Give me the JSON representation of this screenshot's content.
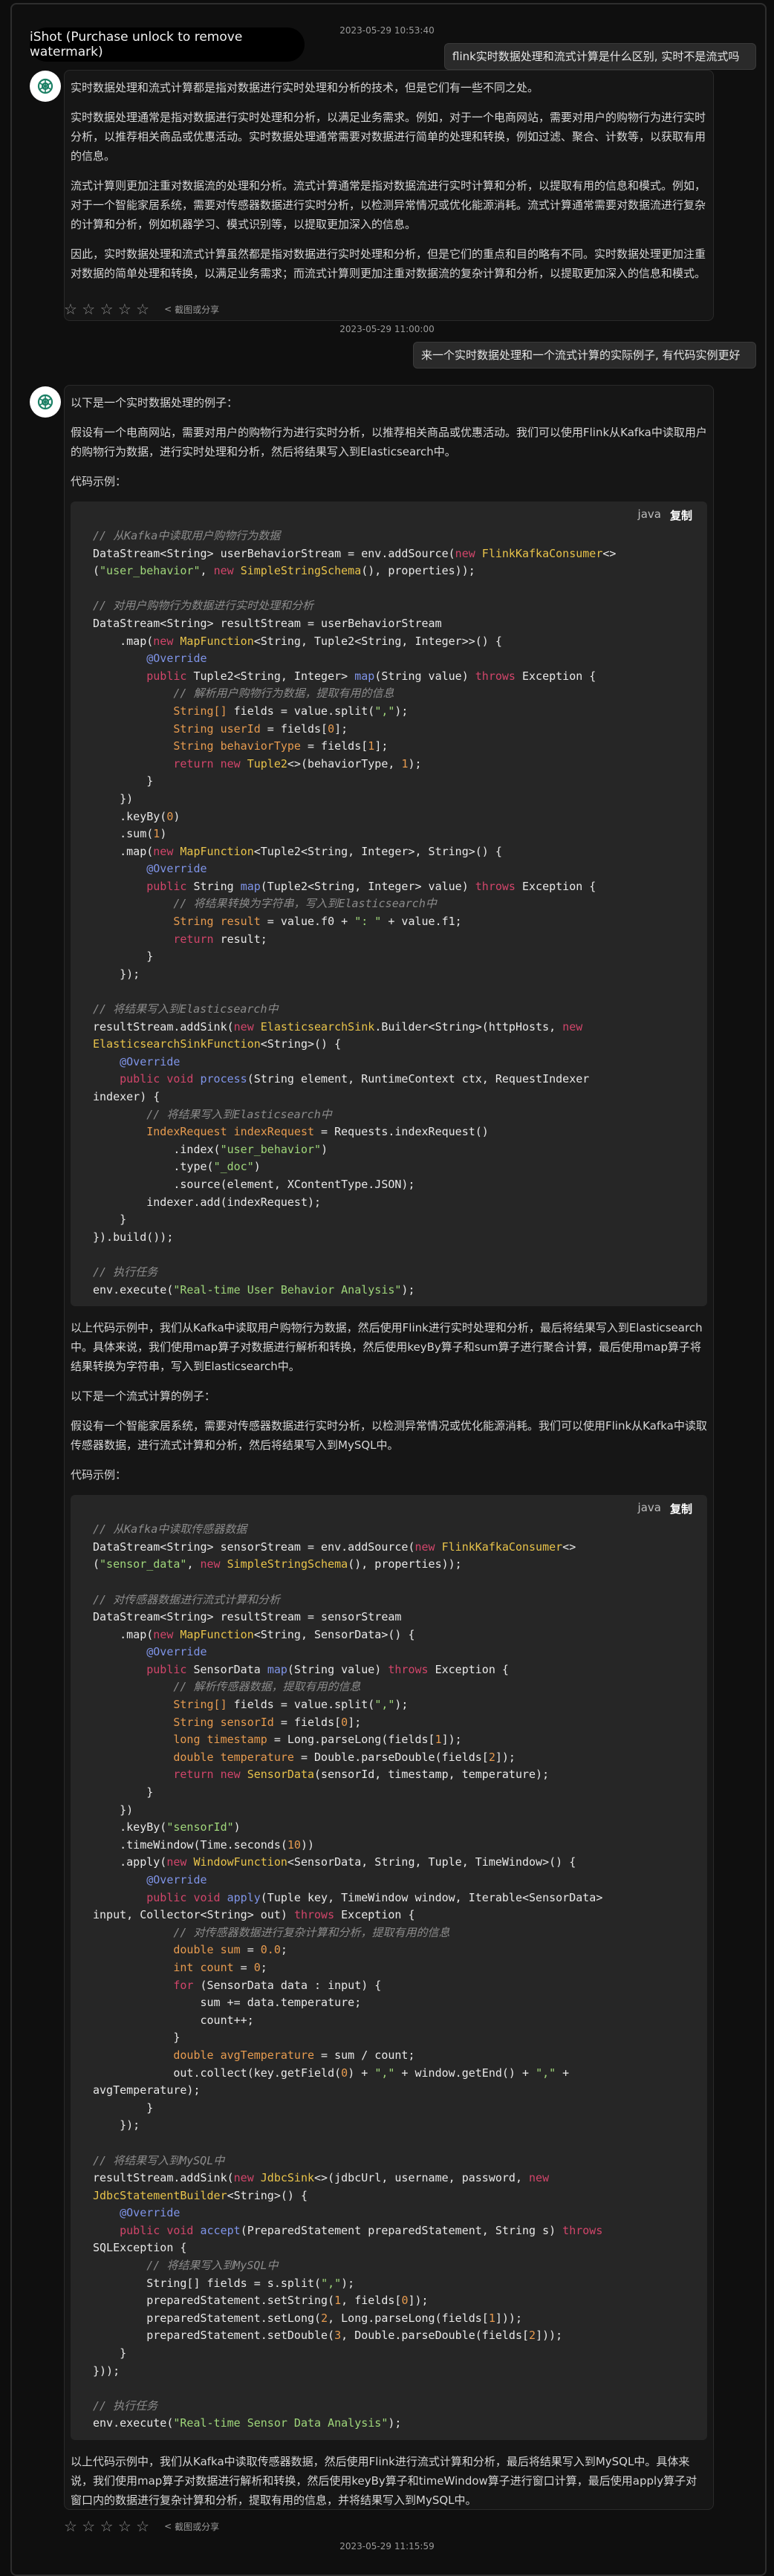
{
  "watermark": "iShot (Purchase unlock to remove watermark)",
  "timestamps": {
    "t1": "2023-05-29 10:53:40",
    "t2": "2023-05-29 11:00:00",
    "t3": "2023-05-29 11:15:59"
  },
  "user": {
    "q1": "flink实时数据处理和流式计算是什么区别, 实时不是流式吗",
    "q2": "来一个实时数据处理和一个流式计算的实际例子, 有代码实例更好"
  },
  "answer1": {
    "p1": "实时数据处理和流式计算都是指对数据进行实时处理和分析的技术，但是它们有一些不同之处。",
    "p2": "实时数据处理通常是指对数据进行实时处理和分析，以满足业务需求。例如，对于一个电商网站，需要对用户的购物行为进行实时分析，以推荐相关商品或优惠活动。实时数据处理通常需要对数据进行简单的处理和转换，例如过滤、聚合、计数等，以获取有用的信息。",
    "p3": "流式计算则更加注重对数据流的处理和分析。流式计算通常是指对数据流进行实时计算和分析，以提取有用的信息和模式。例如，对于一个智能家居系统，需要对传感器数据进行实时分析，以检测异常情况或优化能源消耗。流式计算通常需要对数据流进行复杂的计算和分析，例如机器学习、模式识别等，以提取更加深入的信息。",
    "p4": "因此，实时数据处理和流式计算虽然都是指对数据进行实时处理和分析，但是它们的重点和目的略有不同。实时数据处理更加注重对数据的简单处理和转换，以满足业务需求；而流式计算则更加注重对数据流的复杂计算和分析，以提取更加深入的信息和模式。"
  },
  "answer2": {
    "intro": "以下是一个实时数据处理的例子：",
    "p1": "假设有一个电商网站，需要对用户的购物行为进行实时分析，以推荐相关商品或优惠活动。我们可以使用Flink从Kafka中读取用户的购物行为数据，进行实时处理和分析，然后将结果写入到Elasticsearch中。",
    "codeLabel1": "代码示例：",
    "lang": "java",
    "copy": "复制",
    "p2": "以上代码示例中，我们从Kafka中读取用户购物行为数据，然后使用Flink进行实时处理和分析，最后将结果写入到Elasticsearch中。具体来说，我们使用map算子对数据进行解析和转换，然后使用keyBy算子和sum算子进行聚合计算，最后使用map算子将结果转换为字符串，写入到Elasticsearch中。",
    "intro2": "以下是一个流式计算的例子：",
    "p3": "假设有一个智能家居系统，需要对传感器数据进行实时分析，以检测异常情况或优化能源消耗。我们可以使用Flink从Kafka中读取传感器数据，进行流式计算和分析，然后将结果写入到MySQL中。",
    "codeLabel2": "代码示例：",
    "p4": "以上代码示例中，我们从Kafka中读取传感器数据，然后使用Flink进行流式计算和分析，最后将结果写入到MySQL中。具体来说，我们使用map算子对数据进行解析和转换，然后使用keyBy算子和timeWindow算子进行窗口计算，最后使用apply算子对窗口内的数据进行复杂计算和分析，提取有用的信息，并将结果写入到MySQL中。"
  },
  "rating": {
    "stars": "☆ ☆ ☆ ☆ ☆",
    "share": "截图或分享"
  }
}
